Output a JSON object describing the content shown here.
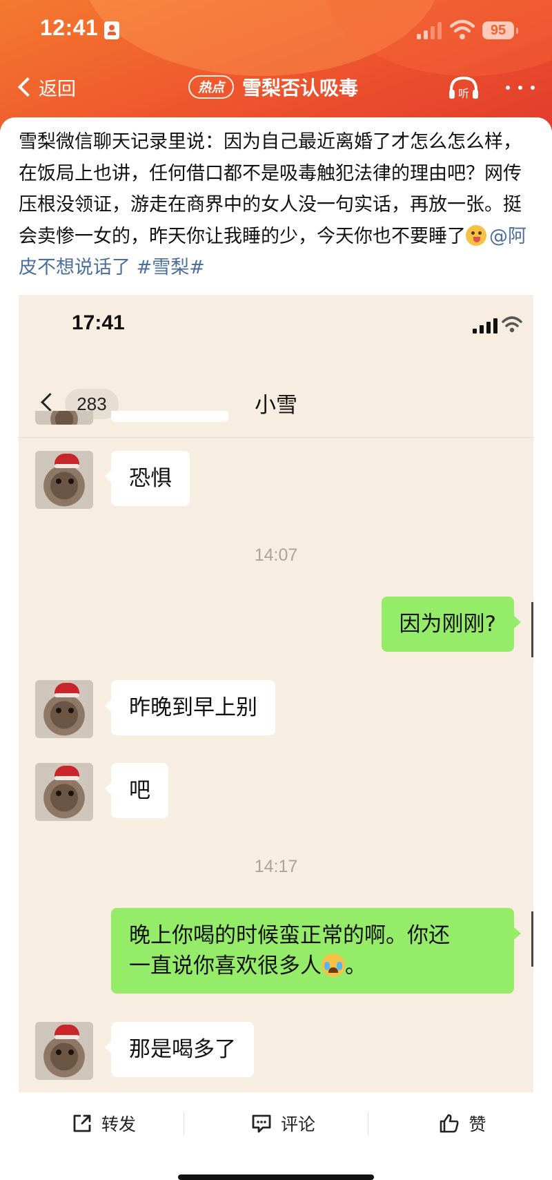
{
  "status_bar": {
    "time": "12:41",
    "battery": "95"
  },
  "header": {
    "back_label": "返回",
    "hot_tag": "热点",
    "title": "雪梨否认吸毒",
    "listen_label": "听"
  },
  "post": {
    "text": "雪梨微信聊天记录里说：因为自己最近离婚了才怎么怎么样，在饭局上也讲，任何借口都不是吸毒触犯法律的理由吧？网传压根没领证，游走在商界中的女人没一句实话，再放一张。挺会卖惨一女的，昨天你让我睡的少，今天你也不要睡了",
    "mention": "@阿皮不想说话了",
    "hashtag": "#雪梨#"
  },
  "chat_screenshot": {
    "status_time": "17:41",
    "unread_count": "283",
    "contact_name": "小雪",
    "messages": [
      {
        "side": "in",
        "text": "恐惧"
      },
      {
        "type": "time",
        "text": "14:07"
      },
      {
        "side": "out",
        "text": "因为刚刚?"
      },
      {
        "side": "in",
        "text": "昨晚到早上别"
      },
      {
        "side": "in",
        "text": "吧"
      },
      {
        "type": "time",
        "text": "14:17"
      },
      {
        "side": "out",
        "line1": "晚上你喝的时候蛮正常的啊。你还",
        "line2": "一直说你喜欢很多人",
        "line2_end": "。"
      },
      {
        "side": "in",
        "text": "那是喝多了"
      }
    ]
  },
  "actions": {
    "repost": "转发",
    "comment": "评论",
    "like": "赞"
  },
  "colors": {
    "header_orange": "#ef5a2e",
    "link_blue": "#4a6f9e",
    "wechat_green": "#95ec69",
    "chat_bg": "#f7ede1"
  }
}
